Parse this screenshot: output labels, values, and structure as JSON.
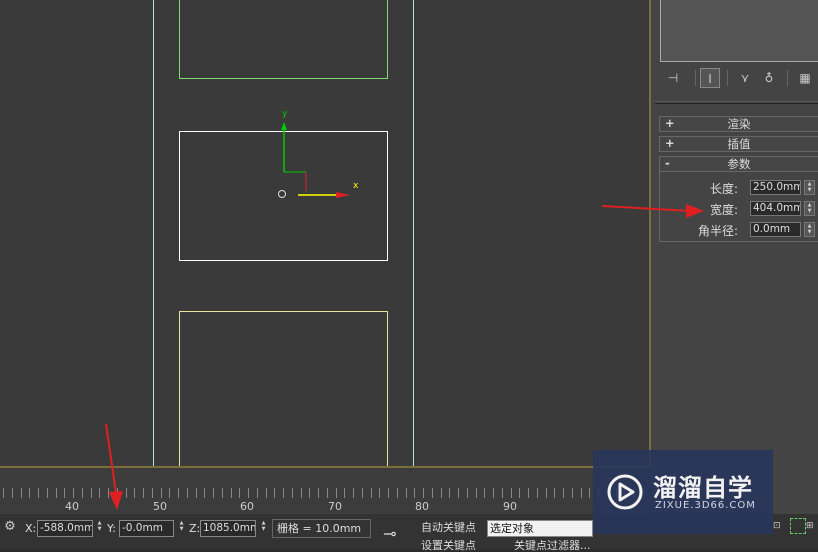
{
  "viewport": {
    "axis_x_label": "x",
    "axis_y_label": "y"
  },
  "command_panel": {
    "rollouts": [
      {
        "sign": "+",
        "title": "渲染"
      },
      {
        "sign": "+",
        "title": "插值"
      },
      {
        "sign": "-",
        "title": "参数"
      }
    ],
    "params": {
      "length_label": "长度:",
      "length_value": "250.0mm",
      "width_label": "宽度:",
      "width_value": "404.0mm",
      "corner_label": "角半径:",
      "corner_value": "0.0mm"
    }
  },
  "timeline": {
    "ticks": [
      "40",
      "50",
      "60",
      "70",
      "80",
      "90"
    ]
  },
  "status_bar": {
    "x_label": "X:",
    "x_value": "-588.0mm",
    "y_label": "Y:",
    "y_value": "-0.0mm",
    "z_label": "Z:",
    "z_value": "1085.0mm",
    "grid": "栅格 = 10.0mm",
    "auto_key": "自动关键点",
    "set_key": "设置关键点",
    "selection_dropdown": "选定对象",
    "key_filters": "关键点过滤器..."
  },
  "watermark": {
    "title": "溜溜自学",
    "url": "ZIXUE.3D66.COM"
  },
  "colors": {
    "viewport_bg": "#3a3a3a",
    "selected_rect": "#ffffff",
    "green_rect": "#7adf6a",
    "yellow_rect": "#e8e29a",
    "cyan_line": "#a8e8e0",
    "gizmo_x": "#ffff00",
    "gizmo_y": "#00cc00",
    "arrow": "#e02020"
  }
}
